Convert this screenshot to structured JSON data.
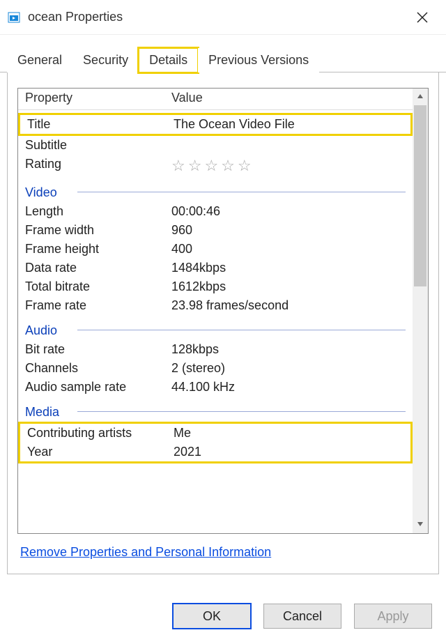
{
  "window": {
    "title": "ocean Properties"
  },
  "tabs": [
    "General",
    "Security",
    "Details",
    "Previous Versions"
  ],
  "active_tab_index": 2,
  "columns": {
    "property": "Property",
    "value": "Value"
  },
  "description": {
    "title_label": "Title",
    "title_value": "The Ocean Video File",
    "subtitle_label": "Subtitle",
    "subtitle_value": "",
    "rating_label": "Rating",
    "rating_value": 0
  },
  "groups": {
    "video": {
      "name": "Video",
      "rows": [
        {
          "label": "Length",
          "value": "00:00:46"
        },
        {
          "label": "Frame width",
          "value": "960"
        },
        {
          "label": "Frame height",
          "value": "400"
        },
        {
          "label": "Data rate",
          "value": "1484kbps"
        },
        {
          "label": "Total bitrate",
          "value": "1612kbps"
        },
        {
          "label": "Frame rate",
          "value": "23.98 frames/second"
        }
      ]
    },
    "audio": {
      "name": "Audio",
      "rows": [
        {
          "label": "Bit rate",
          "value": "128kbps"
        },
        {
          "label": "Channels",
          "value": "2 (stereo)"
        },
        {
          "label": "Audio sample rate",
          "value": "44.100 kHz"
        }
      ]
    },
    "media": {
      "name": "Media",
      "rows": [
        {
          "label": "Contributing artists",
          "value": "Me"
        },
        {
          "label": "Year",
          "value": "2021"
        }
      ]
    }
  },
  "link_text": "Remove Properties and Personal Information",
  "buttons": {
    "ok": "OK",
    "cancel": "Cancel",
    "apply": "Apply"
  },
  "highlights": {
    "details_tab": true,
    "title_row": true,
    "media_rows": true
  }
}
